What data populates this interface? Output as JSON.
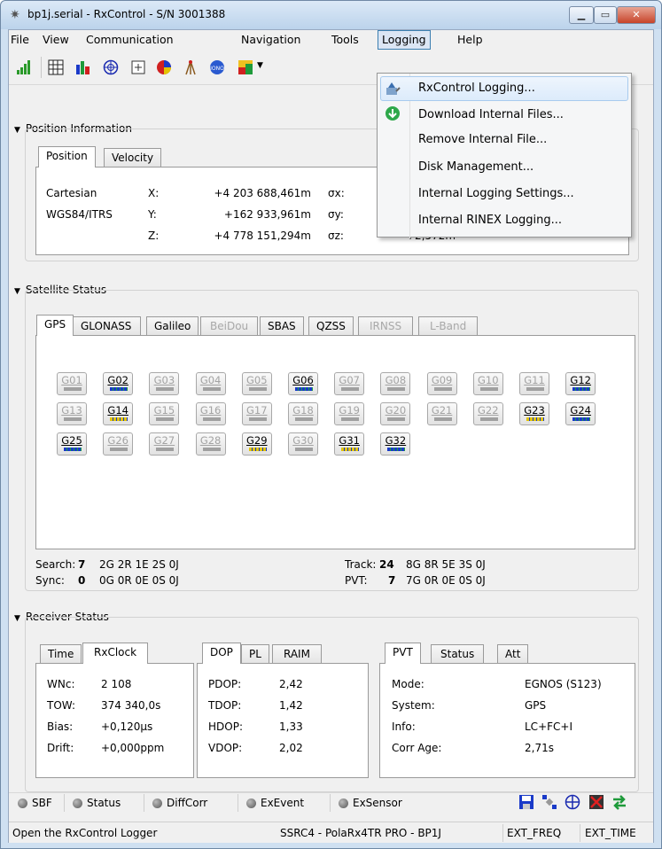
{
  "window": {
    "title": "bp1j.serial - RxControl - S/N 3001388"
  },
  "menu": [
    "File",
    "View",
    "Communication",
    "Navigation",
    "Tools",
    "Logging",
    "Help"
  ],
  "logging_menu": [
    "RxControl Logging...",
    "Download Internal Files...",
    "Remove Internal File...",
    "Disk Management...",
    "Internal Logging Settings...",
    "Internal RINEX Logging..."
  ],
  "position": {
    "section": "Position Information",
    "tabs": [
      "Position",
      "Velocity"
    ],
    "frame1": "Cartesian",
    "frame2": "WGS84/ITRS",
    "x_label": "X:",
    "x_value": "+4 203 688,461m",
    "sx_label": "σx:",
    "y_label": "Y:",
    "y_value": "+162 933,961m",
    "sy_label": "σy:",
    "z_label": "Z:",
    "z_value": "+4 778 151,294m",
    "sz_label": "σz:",
    "sz_value": "+2,572m"
  },
  "satellite": {
    "section": "Satellite Status",
    "tabs": [
      "GPS",
      "GLONASS",
      "Galileo",
      "BeiDou",
      "SBAS",
      "QZSS",
      "IRNSS",
      "L-Band"
    ],
    "sats": [
      {
        "id": "G01",
        "state": "off"
      },
      {
        "id": "G02",
        "state": "blue"
      },
      {
        "id": "G03",
        "state": "off"
      },
      {
        "id": "G04",
        "state": "off"
      },
      {
        "id": "G05",
        "state": "off"
      },
      {
        "id": "G06",
        "state": "blue"
      },
      {
        "id": "G07",
        "state": "off"
      },
      {
        "id": "G08",
        "state": "off"
      },
      {
        "id": "G09",
        "state": "off"
      },
      {
        "id": "G10",
        "state": "off"
      },
      {
        "id": "G11",
        "state": "off"
      },
      {
        "id": "G12",
        "state": "blue"
      },
      {
        "id": "G13",
        "state": "off"
      },
      {
        "id": "G14",
        "state": "yel"
      },
      {
        "id": "G15",
        "state": "off"
      },
      {
        "id": "G16",
        "state": "off"
      },
      {
        "id": "G17",
        "state": "off"
      },
      {
        "id": "G18",
        "state": "off"
      },
      {
        "id": "G19",
        "state": "off"
      },
      {
        "id": "G20",
        "state": "off"
      },
      {
        "id": "G21",
        "state": "off"
      },
      {
        "id": "G22",
        "state": "off"
      },
      {
        "id": "G23",
        "state": "yel"
      },
      {
        "id": "G24",
        "state": "blue"
      },
      {
        "id": "G25",
        "state": "blue"
      },
      {
        "id": "G26",
        "state": "off"
      },
      {
        "id": "G27",
        "state": "off"
      },
      {
        "id": "G28",
        "state": "off"
      },
      {
        "id": "G29",
        "state": "yel"
      },
      {
        "id": "G30",
        "state": "off"
      },
      {
        "id": "G31",
        "state": "yel"
      },
      {
        "id": "G32",
        "state": "blue"
      }
    ],
    "search_label": "Search:",
    "search_count": "7",
    "search_detail": "2G 2R 1E 2S 0J",
    "sync_label": "Sync:",
    "sync_count": "0",
    "sync_detail": "0G 0R 0E 0S 0J",
    "track_label": "Track:",
    "track_count": "24",
    "track_detail": "8G 8R 5E 3S 0J",
    "pvt_label": "PVT:",
    "pvt_count": "7",
    "pvt_detail": "7G 0R 0E 0S 0J"
  },
  "receiver": {
    "section": "Receiver Status",
    "tabs1": [
      "Time",
      "RxClock"
    ],
    "wnc_label": "WNc:",
    "wnc": "2 108",
    "tow_label": "TOW:",
    "tow": "374 340,0s",
    "bias_label": "Bias:",
    "bias": "+0,120µs",
    "drift_label": "Drift:",
    "drift": "+0,000ppm",
    "tabs2": [
      "DOP",
      "PL",
      "RAIM"
    ],
    "pdop_label": "PDOP:",
    "pdop": "2,42",
    "tdop_label": "TDOP:",
    "tdop": "1,42",
    "hdop_label": "HDOP:",
    "hdop": "1,33",
    "vdop_label": "VDOP:",
    "vdop": "2,02",
    "tabs3": [
      "PVT",
      "Status",
      "Att"
    ],
    "mode_label": "Mode:",
    "mode": "EGNOS (S123)",
    "system_label": "System:",
    "system": "GPS",
    "info_label": "Info:",
    "info": "LC+FC+I",
    "corr_label": "Corr Age:",
    "corr": "2,71s"
  },
  "indicators": [
    "SBF",
    "Status",
    "DiffCorr",
    "ExEvent",
    "ExSensor"
  ],
  "status": {
    "hint": "Open the RxControl Logger",
    "device": "SSRC4 - PolaRx4TR PRO - BP1J",
    "ext_freq": "EXT_FREQ",
    "ext_time": "EXT_TIME"
  }
}
